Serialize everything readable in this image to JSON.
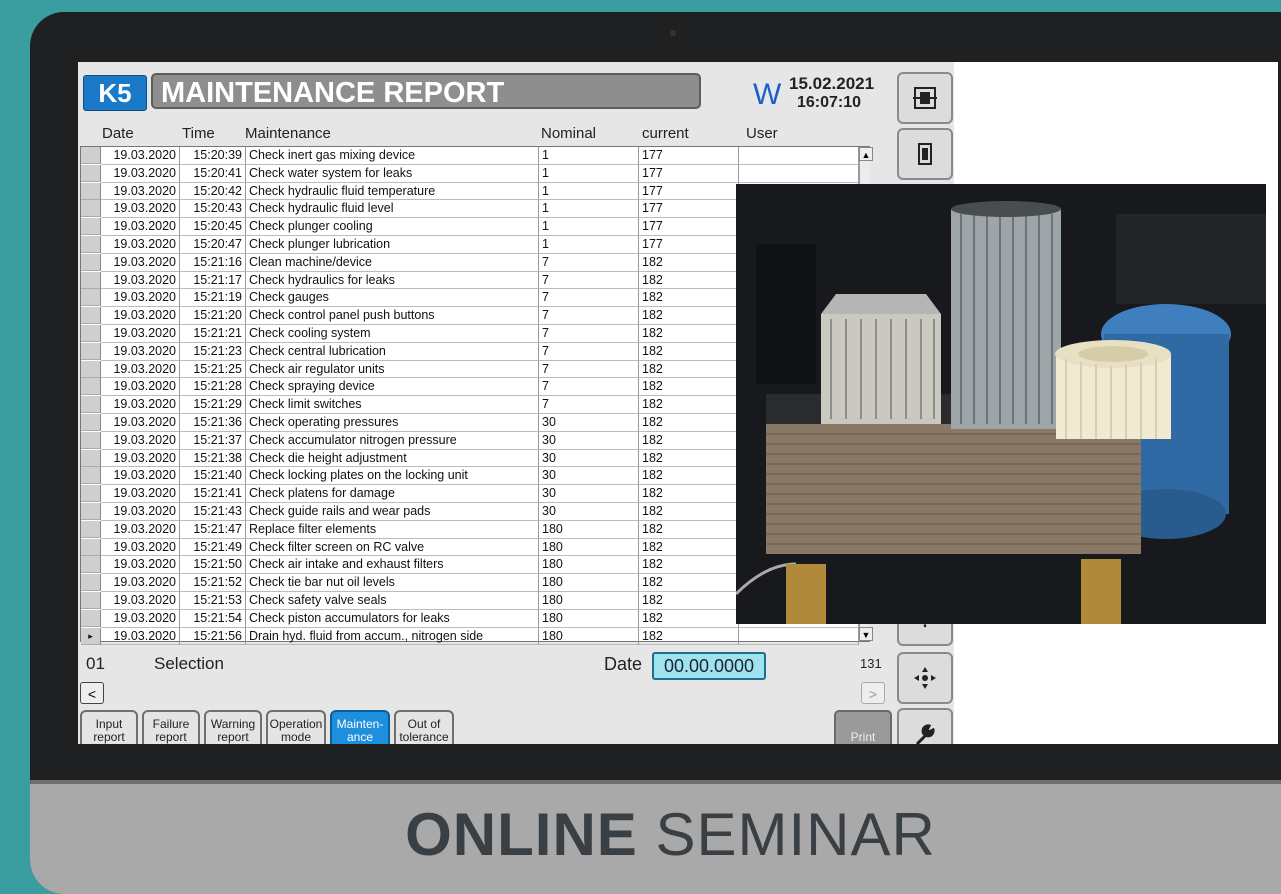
{
  "seminar": {
    "bold": "ONLINE",
    "light": "SEMINAR"
  },
  "hmi": {
    "machine": "K5",
    "title": "MAINTENANCE REPORT",
    "w_label": "W",
    "date": "15.02.2021",
    "time": "16:07:10",
    "columns": [
      "Date",
      "Time",
      "Maintenance",
      "Nominal",
      "current",
      "User"
    ],
    "rows": [
      [
        "19.03.2020",
        "15:20:39",
        "Check inert gas mixing device",
        "1",
        "177",
        ""
      ],
      [
        "19.03.2020",
        "15:20:41",
        "Check water system for leaks",
        "1",
        "177",
        ""
      ],
      [
        "19.03.2020",
        "15:20:42",
        "Check hydraulic fluid temperature",
        "1",
        "177",
        ""
      ],
      [
        "19.03.2020",
        "15:20:43",
        "Check hydraulic fluid level",
        "1",
        "177",
        ""
      ],
      [
        "19.03.2020",
        "15:20:45",
        "Check plunger cooling",
        "1",
        "177",
        ""
      ],
      [
        "19.03.2020",
        "15:20:47",
        "Check plunger lubrication",
        "1",
        "177",
        ""
      ],
      [
        "19.03.2020",
        "15:21:16",
        "Clean machine/device",
        "7",
        "182",
        ""
      ],
      [
        "19.03.2020",
        "15:21:17",
        "Check hydraulics for leaks",
        "7",
        "182",
        ""
      ],
      [
        "19.03.2020",
        "15:21:19",
        "Check gauges",
        "7",
        "182",
        ""
      ],
      [
        "19.03.2020",
        "15:21:20",
        "Check control panel push buttons",
        "7",
        "182",
        ""
      ],
      [
        "19.03.2020",
        "15:21:21",
        "Check cooling system",
        "7",
        "182",
        ""
      ],
      [
        "19.03.2020",
        "15:21:23",
        "Check central lubrication",
        "7",
        "182",
        ""
      ],
      [
        "19.03.2020",
        "15:21:25",
        "Check air regulator units",
        "7",
        "182",
        ""
      ],
      [
        "19.03.2020",
        "15:21:28",
        "Check spraying device",
        "7",
        "182",
        ""
      ],
      [
        "19.03.2020",
        "15:21:29",
        "Check limit switches",
        "7",
        "182",
        ""
      ],
      [
        "19.03.2020",
        "15:21:36",
        "Check operating pressures",
        "30",
        "182",
        ""
      ],
      [
        "19.03.2020",
        "15:21:37",
        "Check accumulator nitrogen pressure",
        "30",
        "182",
        ""
      ],
      [
        "19.03.2020",
        "15:21:38",
        "Check die height adjustment",
        "30",
        "182",
        ""
      ],
      [
        "19.03.2020",
        "15:21:40",
        "Check locking plates on the locking unit",
        "30",
        "182",
        ""
      ],
      [
        "19.03.2020",
        "15:21:41",
        "Check platens for damage",
        "30",
        "182",
        ""
      ],
      [
        "19.03.2020",
        "15:21:43",
        "Check guide rails and wear pads",
        "30",
        "182",
        ""
      ],
      [
        "19.03.2020",
        "15:21:47",
        "Replace filter elements",
        "180",
        "182",
        ""
      ],
      [
        "19.03.2020",
        "15:21:49",
        "Check filter screen on RC valve",
        "180",
        "182",
        ""
      ],
      [
        "19.03.2020",
        "15:21:50",
        "Check air intake and exhaust filters",
        "180",
        "182",
        ""
      ],
      [
        "19.03.2020",
        "15:21:52",
        "Check tie bar nut oil levels",
        "180",
        "182",
        ""
      ],
      [
        "19.03.2020",
        "15:21:53",
        "Check safety valve seals",
        "180",
        "182",
        ""
      ],
      [
        "19.03.2020",
        "15:21:54",
        "Check piston accumulators for leaks",
        "180",
        "182",
        ""
      ],
      [
        "19.03.2020",
        "15:21:56",
        "Drain hyd. fluid from accum., nitrogen side",
        "180",
        "182",
        ""
      ]
    ],
    "footer": {
      "index": "01",
      "selection": "Selection",
      "date_label": "Date",
      "date_value": "00.00.0000",
      "count": "131"
    },
    "nav": {
      "prev": "<",
      "next": ">"
    },
    "tabs": [
      {
        "label": "Input report",
        "active": false
      },
      {
        "label": "Failure report",
        "active": false
      },
      {
        "label": "Warning report",
        "active": false
      },
      {
        "label": "Operation mode",
        "active": false
      },
      {
        "label": "Mainten-ance",
        "active": true
      },
      {
        "label": "Out of tolerance",
        "active": false
      }
    ],
    "print": "Print"
  },
  "colors": {
    "background": "#3a9ea0",
    "accent_blue": "#1b7ac8",
    "active_tab": "#1e8fdc",
    "date_box": "#9fe3ef"
  },
  "icons": [
    "machine-front-icon",
    "machine-side-icon",
    "move-icon",
    "wrench-icon",
    "scroll-up-icon",
    "scroll-down-icon"
  ]
}
